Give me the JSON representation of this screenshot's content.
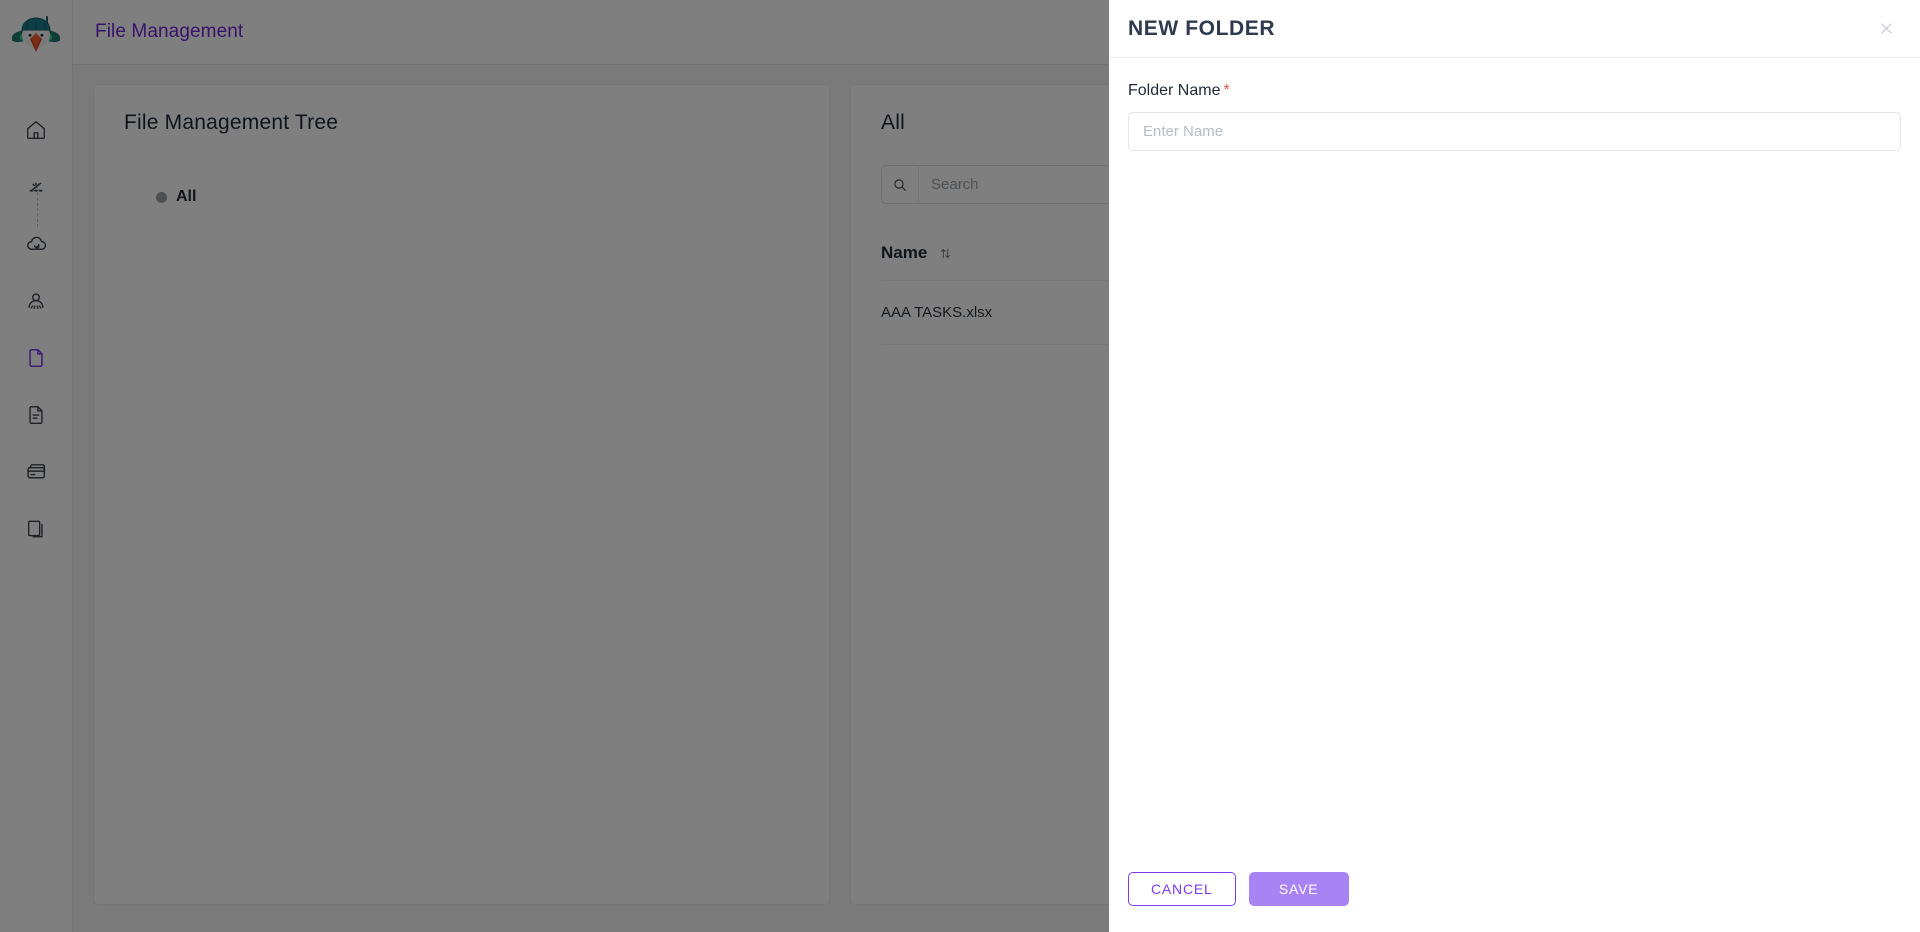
{
  "app": {
    "logo_name": "bird-mascot-logo",
    "topbar_title": "File Management"
  },
  "sidebar": {
    "items": [
      {
        "icon": "home-icon",
        "name": "sidebar-item-home",
        "active": false
      },
      {
        "icon": "sitemap-icon",
        "name": "sidebar-item-sitemap",
        "active": false
      },
      {
        "icon": "cloud-sync-icon",
        "name": "sidebar-item-cloud",
        "active": false
      },
      {
        "icon": "user-icon",
        "name": "sidebar-item-user",
        "active": false
      },
      {
        "icon": "file-icon",
        "name": "sidebar-item-files",
        "active": true
      },
      {
        "icon": "document-icon",
        "name": "sidebar-item-documents",
        "active": false
      },
      {
        "icon": "credit-card-icon",
        "name": "sidebar-item-billing",
        "active": false
      },
      {
        "icon": "pages-icon",
        "name": "sidebar-item-pages",
        "active": false
      }
    ]
  },
  "tree_panel": {
    "title": "File Management Tree",
    "root_node": "All"
  },
  "list_panel": {
    "title": "All",
    "search": {
      "placeholder": "Search",
      "value": ""
    },
    "columns": [
      "Name"
    ],
    "rows": [
      {
        "name": "AAA TASKS.xlsx"
      }
    ]
  },
  "modal": {
    "title": "NEW FOLDER",
    "close_label": "✕",
    "field": {
      "label": "Folder Name",
      "required_marker": "*",
      "placeholder": "Enter Name",
      "value": ""
    },
    "buttons": {
      "cancel": "CANCEL",
      "save": "SAVE"
    }
  },
  "colors": {
    "brand_purple": "#6d28d9",
    "accent_purple": "#7c3aed",
    "save_purple": "#a983f4",
    "required_red": "#e8514d",
    "title_navy": "#2f3a4f",
    "overlay": "rgba(0,0,0,0.50)"
  }
}
